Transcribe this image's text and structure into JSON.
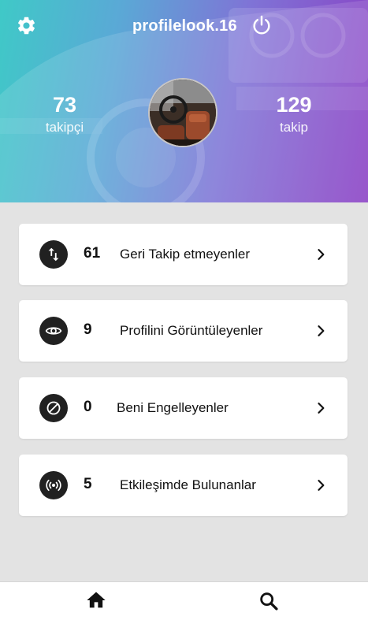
{
  "header": {
    "username": "profilelook.16",
    "icons": {
      "settings": "gear-icon",
      "power": "power-icon"
    },
    "followers": {
      "count": "73",
      "label": "takipçi"
    },
    "following": {
      "count": "129",
      "label": "takip"
    },
    "gradient_colors": [
      "#3fc9c7",
      "#7f74d6",
      "#8a3fc4"
    ]
  },
  "cards": [
    {
      "count": "61",
      "label": "Geri Takip etmeyenler",
      "icon": "swap-vertical-icon"
    },
    {
      "count": "9",
      "label": "Profilini Görüntüleyenler",
      "icon": "eye-icon"
    },
    {
      "count": "0",
      "label": "Beni Engelleyenler",
      "icon": "block-icon"
    },
    {
      "count": "5",
      "label": "Etkileşimde Bulunanlar",
      "icon": "broadcast-icon"
    }
  ],
  "bottom_nav": [
    {
      "icon": "home-icon"
    },
    {
      "icon": "search-icon"
    }
  ],
  "colors": {
    "background": "#e3e3e3",
    "card": "#ffffff",
    "badge": "#212121",
    "text": "#111111"
  }
}
